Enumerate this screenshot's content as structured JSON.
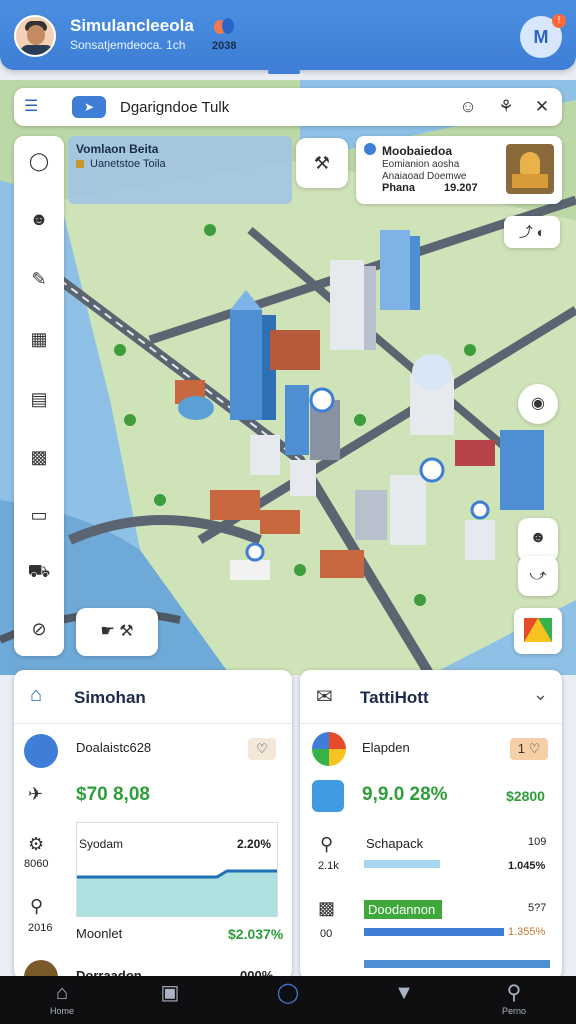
{
  "header": {
    "title": "Simulancleeola",
    "subtitle": "Sonsatjemdeoca. 1ch",
    "badge_text": "2038",
    "notification_count": "!",
    "profile_glyph": "M"
  },
  "search": {
    "value": "Dgarigndoe Tulk",
    "mode_icon": "arrow-right-icon"
  },
  "map_overlays": {
    "info_line1": "Vomlaon Beita",
    "info_line2": "Uanetstoe  Toila",
    "poi": {
      "title": "Moobaiedoa",
      "subtitle": "Eomianion aosha Anaiaoad Doemwe",
      "price_label": "Phana",
      "price_value": "19.207"
    }
  },
  "cards": {
    "left": {
      "title": "Simohan",
      "row1_label": "Doalaistc628",
      "row1_value": "$70 8,08",
      "side1": "8060",
      "chart_label": "Syodam",
      "chart_value": "2.20%",
      "side2": "2016",
      "footer_label": "Moonlet",
      "footer_value": "$2.037%",
      "peek_label": "Dorraadon",
      "peek_value": "000%"
    },
    "right": {
      "title": "TattiHott",
      "row1_label": "Elapden",
      "row1_badge": "1",
      "big_value": "9,9.0 28%",
      "small_value": "$2800",
      "metric1_label": "Schapack",
      "metric1_value": "1.045%",
      "metric1_extra": "109",
      "side1": "2.1k",
      "metric2_label": "Doodannon",
      "metric2_value": "1.355%",
      "metric2_extra": "5?7",
      "side2": "00"
    }
  },
  "nav": {
    "items": [
      {
        "label": "Home",
        "icon": "home-icon"
      },
      {
        "label": "",
        "icon": "square-icon"
      },
      {
        "label": "",
        "icon": "circle-icon"
      },
      {
        "label": "",
        "icon": "triangle-icon"
      },
      {
        "label": "Perno",
        "icon": "search-icon"
      }
    ]
  },
  "colors": {
    "accent": "#3e7ed6",
    "positive": "#2e9d3a",
    "water": "#8fc0e6",
    "land": "#cfe3b8"
  }
}
